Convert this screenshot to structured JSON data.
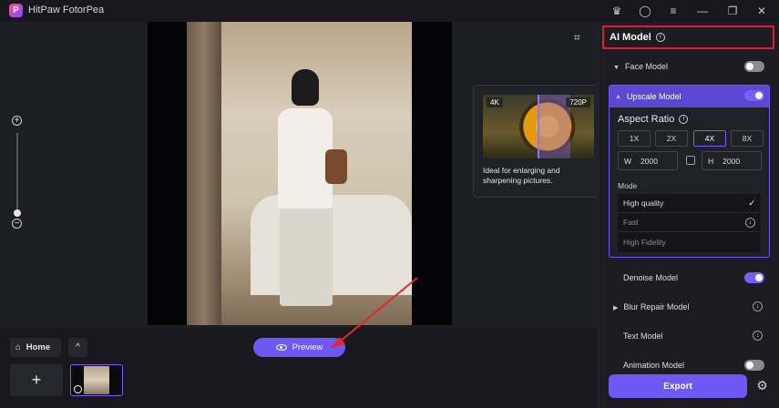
{
  "app": {
    "title": "HitPaw FotorPea",
    "logo_letter": "P"
  },
  "titlebar_icons": [
    "crown-icon",
    "user-icon",
    "menu-icon",
    "minimize-icon",
    "restore-icon",
    "close-icon"
  ],
  "zoom": {
    "plus": "+",
    "minus": "−"
  },
  "tooltip": {
    "badge_left": "4K",
    "badge_right": "720P",
    "text": "Ideal for enlarging and sharpening pictures."
  },
  "bottom": {
    "home_label": "Home",
    "up_glyph": "^",
    "add_glyph": "+",
    "preview_label": "Preview"
  },
  "panel": {
    "title": "AI Model",
    "info_glyph": "i",
    "face_model": {
      "label": "Face Model",
      "enabled": false
    },
    "upscale_model": {
      "label": "Upscale Model",
      "enabled": true,
      "aspect_ratio_title": "Aspect Ratio",
      "ratios": [
        "1X",
        "2X",
        "4X",
        "8X"
      ],
      "selected_ratio": "4X",
      "width_label": "W",
      "width_value": "2000",
      "height_label": "H",
      "height_value": "2000",
      "mode_title": "Mode",
      "modes": [
        "High quality",
        "Fast",
        "High Fidelity"
      ],
      "selected_mode": "High quality"
    },
    "denoise_model": {
      "label": "Denoise Model",
      "enabled": true
    },
    "blur_repair_model": {
      "label": "Blur Repair Model"
    },
    "text_model": {
      "label": "Text Model"
    },
    "animation_model": {
      "label": "Animation Model",
      "enabled": false
    },
    "export_label": "Export"
  },
  "colors": {
    "accent": "#6d58f3",
    "highlight": "#d92030",
    "toggle_on": "#7a5cff"
  }
}
